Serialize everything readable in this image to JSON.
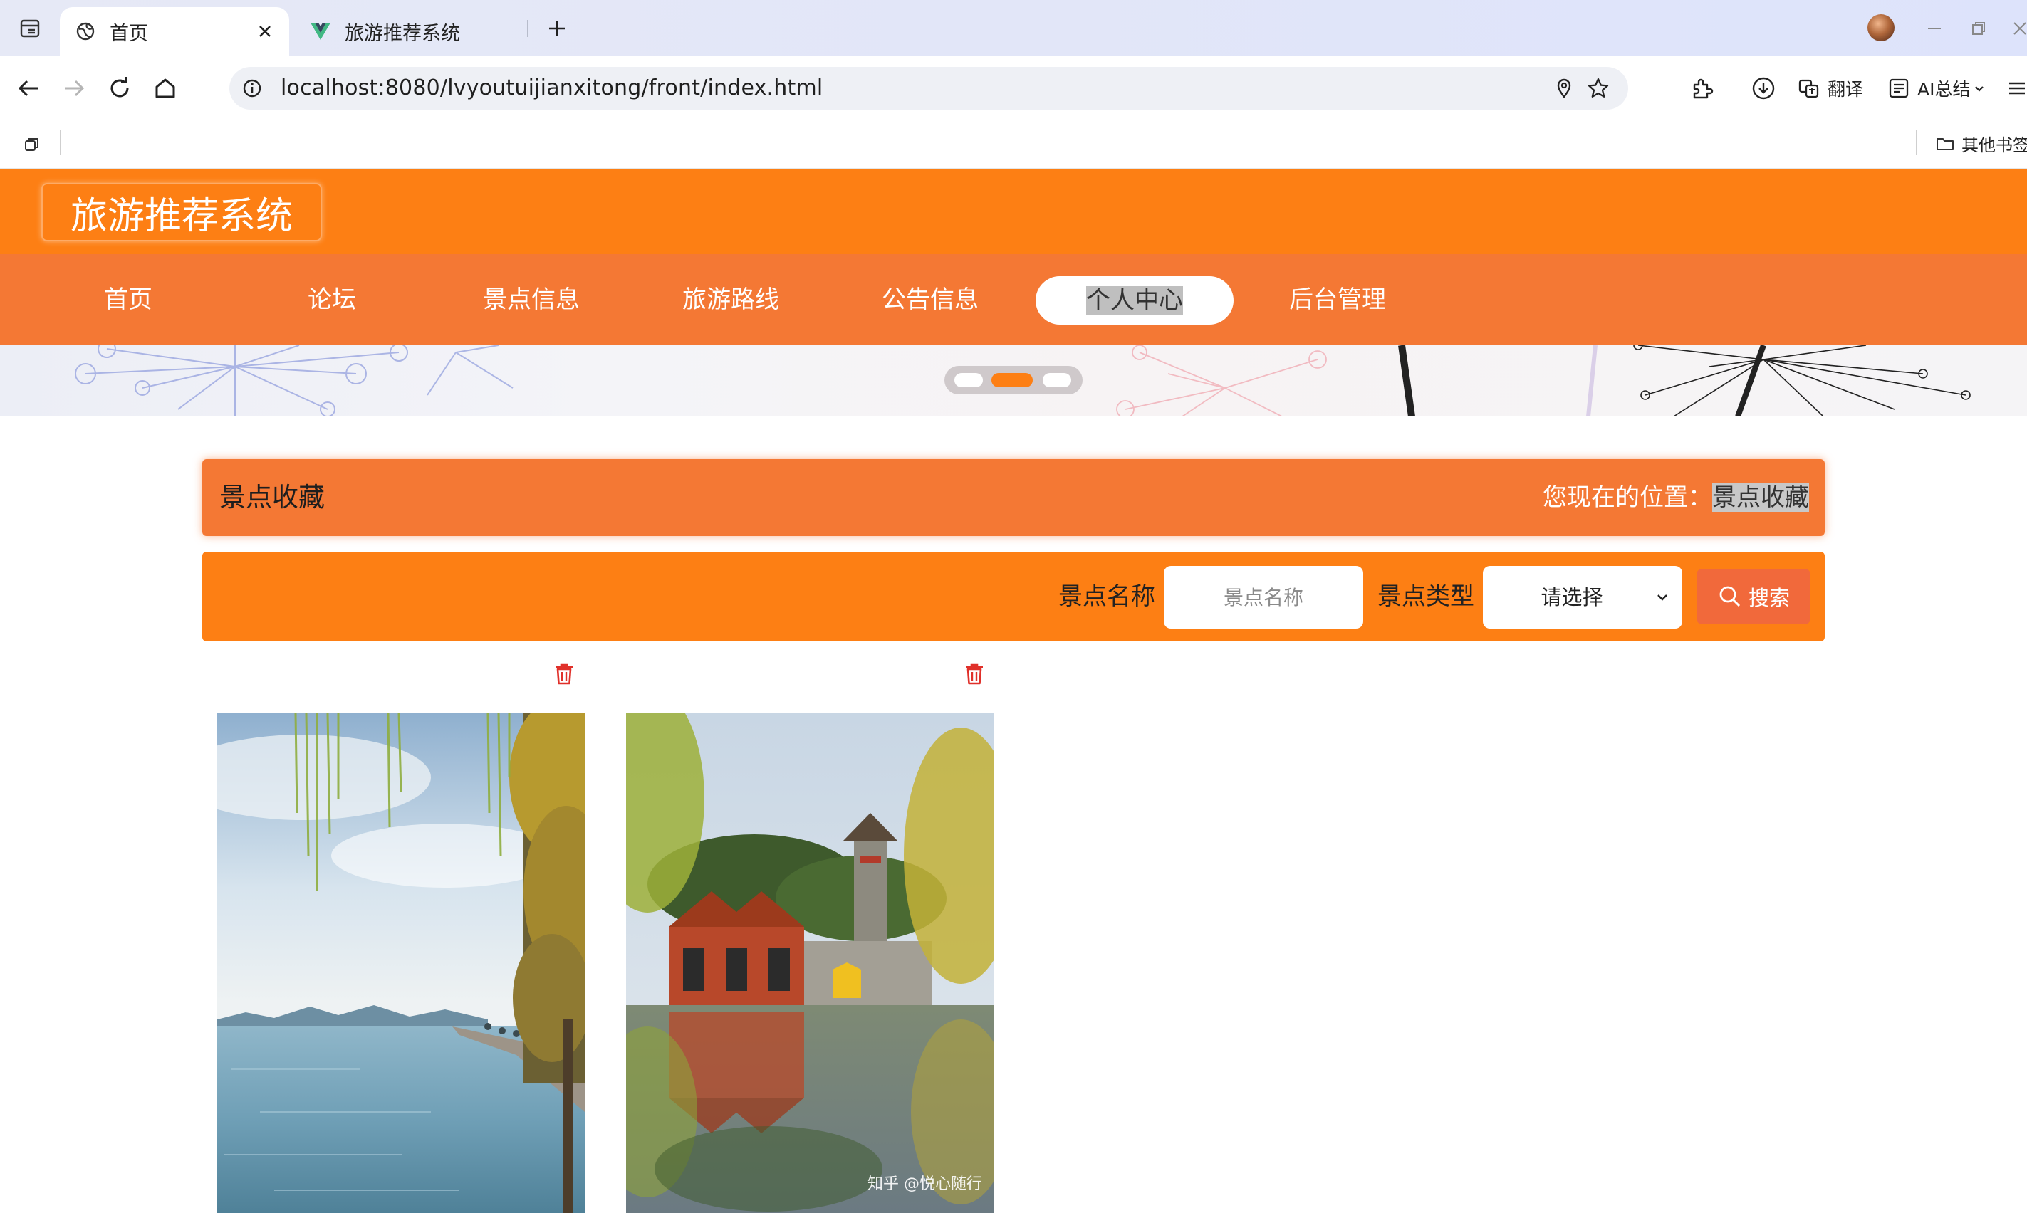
{
  "browser": {
    "tabs": [
      {
        "title": "首页",
        "active": true
      },
      {
        "title": "旅游推荐系统",
        "active": false
      }
    ],
    "address": "localhost:8080/lvyoutuijianxitong/front/index.html",
    "toolbar": {
      "translate": "翻译",
      "ai_summary": "AI总结"
    },
    "bookmarks": {
      "other": "其他书签"
    }
  },
  "site": {
    "logo": "旅游推荐系统",
    "nav": [
      {
        "label": "首页"
      },
      {
        "label": "论坛"
      },
      {
        "label": "景点信息"
      },
      {
        "label": "旅游路线"
      },
      {
        "label": "公告信息"
      },
      {
        "label": "个人中心",
        "active": true
      },
      {
        "label": "后台管理"
      }
    ],
    "carousel": {
      "slide_count": 3,
      "active_index": 1
    }
  },
  "breadcrumb": {
    "title": "景点收藏",
    "location_label": "您现在的位置：",
    "current": "景点收藏"
  },
  "search": {
    "name_label": "景点名称",
    "name_placeholder": "景点名称",
    "type_label": "景点类型",
    "type_value": "请选择",
    "button": "搜索"
  },
  "favorites": [
    {
      "type": "lake-willow"
    },
    {
      "type": "summer-palace",
      "watermark": "知乎 @悦心随行"
    }
  ],
  "colors": {
    "header": "#fd7f14",
    "nav": "#f47834",
    "search_button": "#f1693b",
    "trash": "#e0302a"
  }
}
